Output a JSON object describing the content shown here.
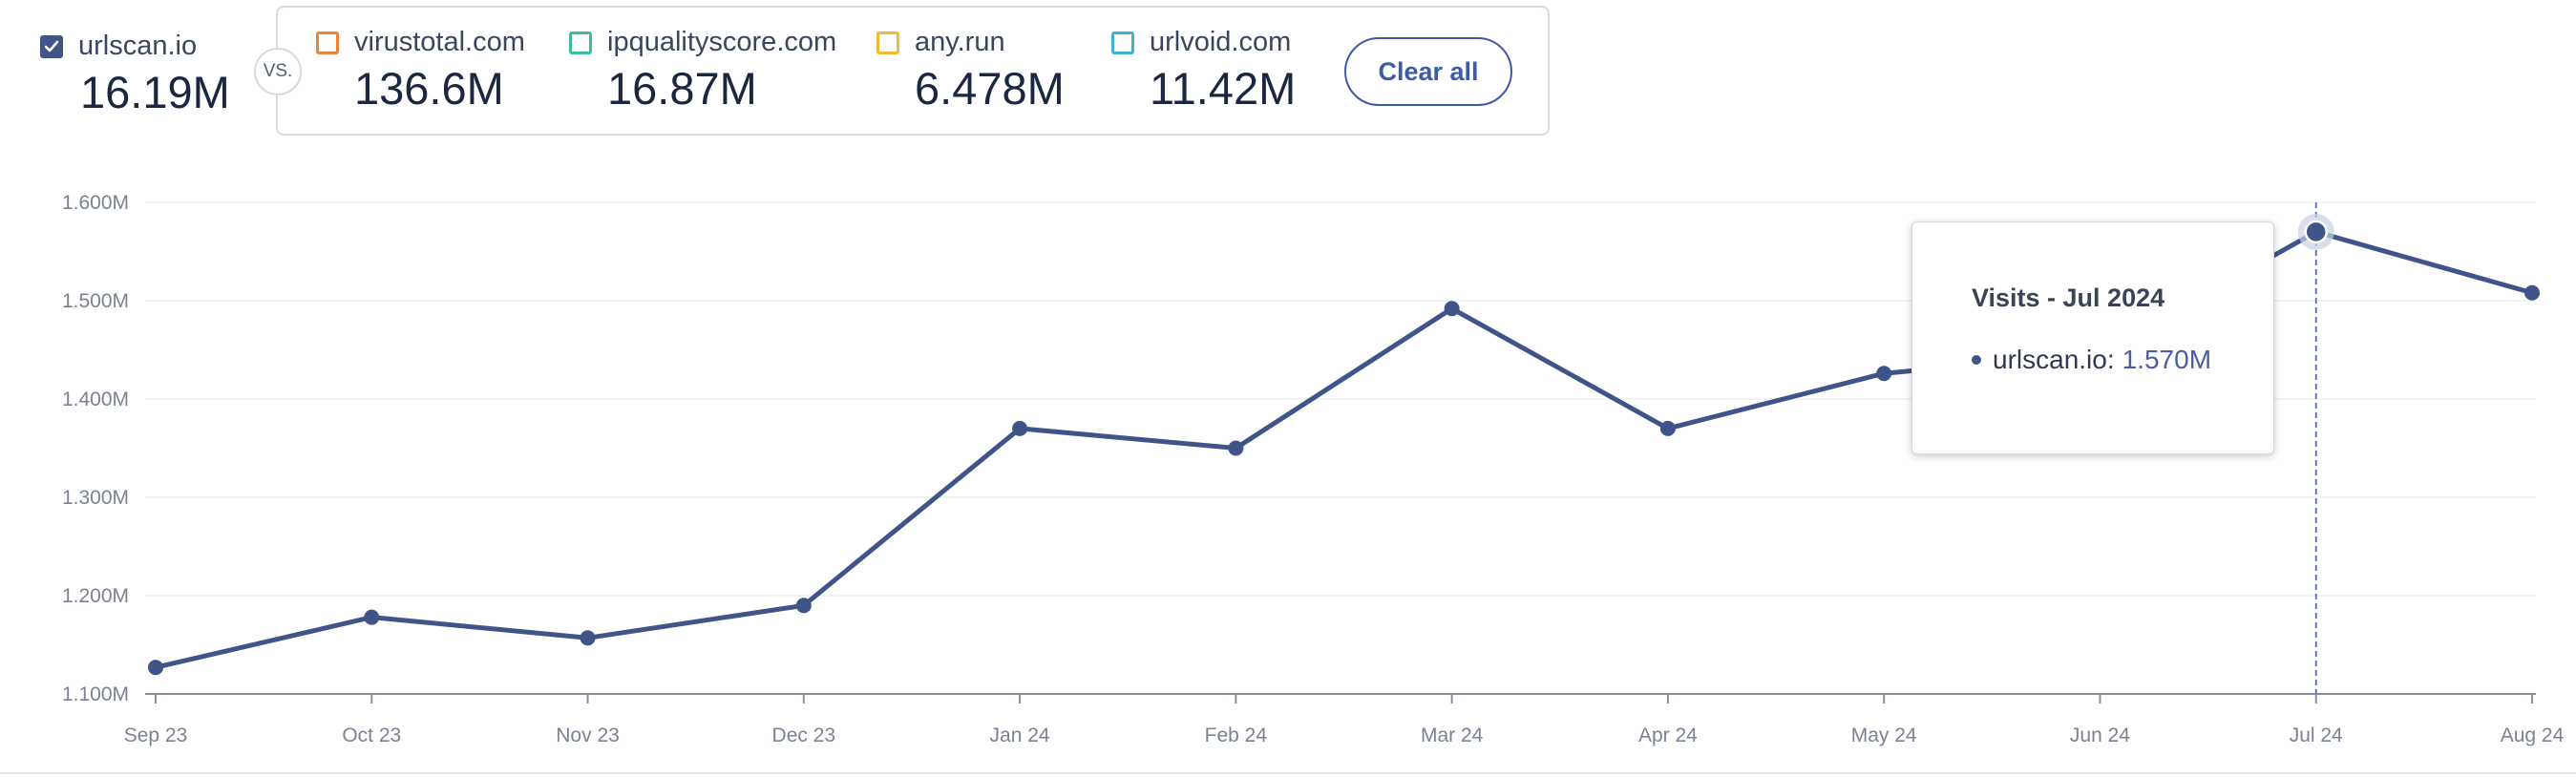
{
  "header": {
    "main_site": {
      "name": "urlscan.io",
      "value": "16.19M",
      "checked": true,
      "color": "#3f5589"
    },
    "vs_label": "VS.",
    "competitors": [
      {
        "name": "virustotal.com",
        "value": "136.6M",
        "color": "#e8843c",
        "checked": false
      },
      {
        "name": "ipqualityscore.com",
        "value": "16.87M",
        "color": "#3ebca0",
        "checked": false
      },
      {
        "name": "any.run",
        "value": "6.478M",
        "color": "#f2b933",
        "checked": false
      },
      {
        "name": "urlvoid.com",
        "value": "11.42M",
        "color": "#3bb4d6",
        "checked": false
      }
    ],
    "clear_all_label": "Clear all"
  },
  "tooltip": {
    "title": "Visits - Jul 2024",
    "series_label": "urlscan.io:",
    "value": "1.570M"
  },
  "colors": {
    "series": "#3f5589",
    "grid": "#ebedf1",
    "axis": "#8a8f9c",
    "crosshair": "#4a6dc4",
    "tick_text": "#7b8294"
  },
  "chart_data": {
    "type": "line",
    "title": "",
    "xlabel": "",
    "ylabel": "",
    "categories": [
      "Sep 23",
      "Oct 23",
      "Nov 23",
      "Dec 23",
      "Jan 24",
      "Feb 24",
      "Mar 24",
      "Apr 24",
      "May 24",
      "Jun 24",
      "Jul 24",
      "Aug 24"
    ],
    "series": [
      {
        "name": "urlscan.io",
        "values": [
          1.127,
          1.178,
          1.157,
          1.19,
          1.37,
          1.35,
          1.492,
          1.37,
          1.426,
          1.447,
          1.57,
          1.508
        ]
      }
    ],
    "y_ticks": [
      1.1,
      1.2,
      1.3,
      1.4,
      1.5,
      1.6
    ],
    "y_tick_labels": [
      "1.100M",
      "1.200M",
      "1.300M",
      "1.400M",
      "1.500M",
      "1.600M"
    ],
    "ylim": [
      1.1,
      1.6
    ],
    "grid": true,
    "highlighted_category": "Jul 24"
  }
}
